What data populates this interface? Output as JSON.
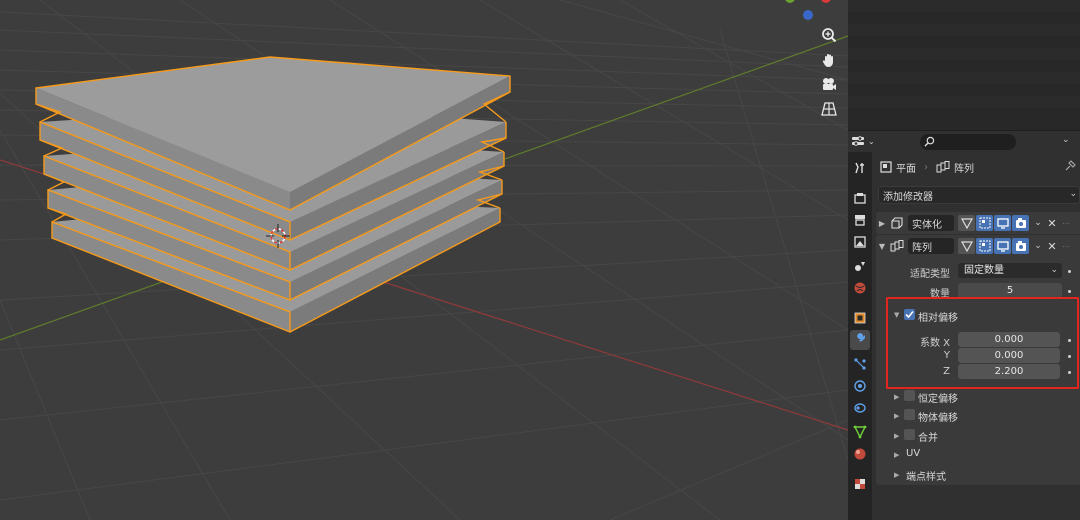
{
  "viewport": {
    "colors": {
      "background": "#3d3d3d",
      "grid": "#474747",
      "x_axis": "#8e3a3a",
      "y_axis": "#5f7d2c",
      "selection_outline": "#f59a1b",
      "mesh_top": "#9a9a9a",
      "mesh_front": "#8a8a8a",
      "mesh_side": "#7d7d7d"
    },
    "nav_icons": [
      "zoom-icon",
      "pan-hand-icon",
      "camera-icon",
      "perspective-grid-icon"
    ],
    "axis_dots": [
      "#6aa22e",
      "#d93a3a",
      "#3a68c8"
    ]
  },
  "properties": {
    "breadcrumb": {
      "object_name": "平面",
      "modifier_name": "阵列"
    },
    "add_modifier_label": "添加修改器",
    "modifiers": [
      {
        "name": "实体化",
        "collapsed": true
      },
      {
        "name": "阵列",
        "collapsed": false,
        "fit_type_label": "适配类型",
        "fit_type_value": "固定数量",
        "count_label": "数量",
        "count_value": "5",
        "relative_offset": {
          "label": "相对偏移",
          "enabled": true,
          "factor_x_label": "系数 X",
          "factor_x_value": "0.000",
          "y_label": "Y",
          "y_value": "0.000",
          "z_label": "Z",
          "z_value": "2.200"
        },
        "subpanels": [
          {
            "label": "恒定偏移",
            "has_checkbox": true
          },
          {
            "label": "物体偏移",
            "has_checkbox": true
          },
          {
            "label": "合并",
            "has_checkbox": true
          },
          {
            "label": "UV",
            "has_checkbox": false
          },
          {
            "label": "端点样式",
            "has_checkbox": false
          }
        ]
      }
    ],
    "accent_color": "#4772b3",
    "highlight_color": "#e0261f"
  }
}
